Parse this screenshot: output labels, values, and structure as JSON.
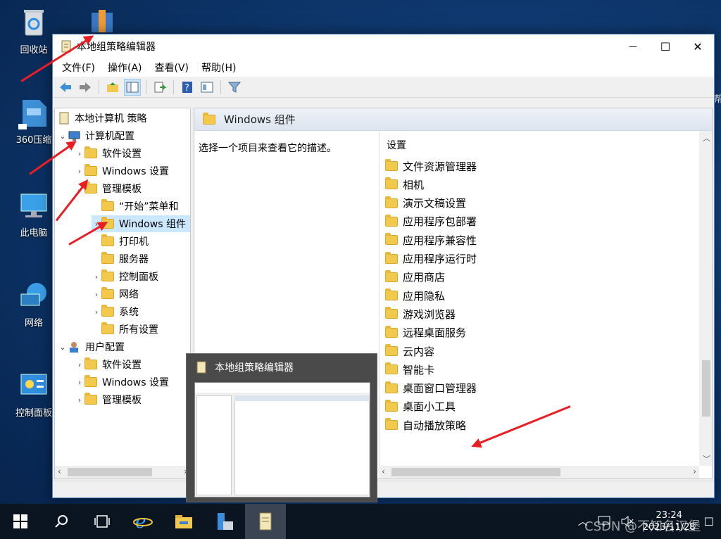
{
  "desktop": {
    "icons": [
      {
        "label": "回收站"
      },
      {
        "label": "360压缩"
      },
      {
        "label": "此电脑"
      },
      {
        "label": "网络"
      },
      {
        "label": "控制面板"
      }
    ],
    "right_edge_text": "帮"
  },
  "window": {
    "title": "本地组策略编辑器",
    "controls": {
      "minimize": "—",
      "maximize": "☐",
      "close": "✕"
    },
    "menu": [
      "文件(F)",
      "操作(A)",
      "查看(V)",
      "帮助(H)"
    ],
    "tree": {
      "root": "本地计算机 策略",
      "computer_config": "计算机配置",
      "software_settings": "软件设置",
      "windows_settings": "Windows 设置",
      "admin_templates": "管理模板",
      "start_menu": "“开始”菜单和",
      "windows_components": "Windows 组件",
      "printers": "打印机",
      "server": "服务器",
      "control_panel": "控制面板",
      "network": "网络",
      "system": "系统",
      "all_settings": "所有设置",
      "user_config": "用户配置",
      "user_software": "软件设置",
      "user_windows": "Windows 设置",
      "user_admin": "管理模板"
    },
    "right": {
      "header": "Windows 组件",
      "description": "选择一个项目来查看它的描述。",
      "column_header": "设置",
      "items": [
        "文件资源管理器",
        "相机",
        "演示文稿设置",
        "应用程序包部署",
        "应用程序兼容性",
        "应用程序运行时",
        "应用商店",
        "应用隐私",
        "游戏浏览器",
        "远程桌面服务",
        "云内容",
        "智能卡",
        "桌面窗口管理器",
        "桌面小工具",
        "自动播放策略"
      ]
    }
  },
  "thumbnail": {
    "title": "本地组策略编辑器"
  },
  "taskbar": {
    "clock_time": "23:24",
    "clock_date": "2023/11/28"
  },
  "watermark": "CSDN @不知名汉堡"
}
